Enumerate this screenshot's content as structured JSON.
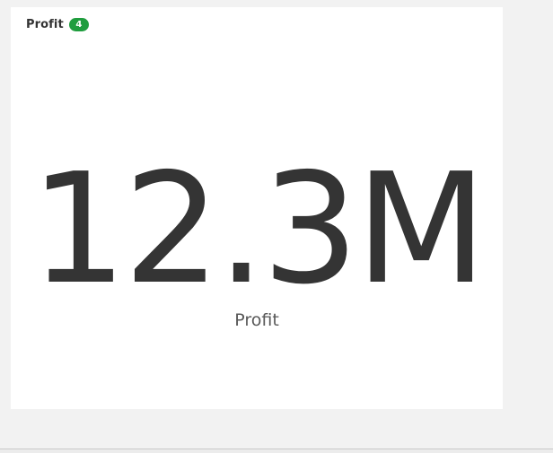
{
  "card": {
    "title": "Profit",
    "badge": "4"
  },
  "kpi": {
    "value": "12.3M",
    "label": "Profit"
  },
  "colors": {
    "badge_bg": "#1f9d3e",
    "value_text": "#343434",
    "page_bg": "#f2f2f2",
    "card_bg": "#ffffff"
  }
}
